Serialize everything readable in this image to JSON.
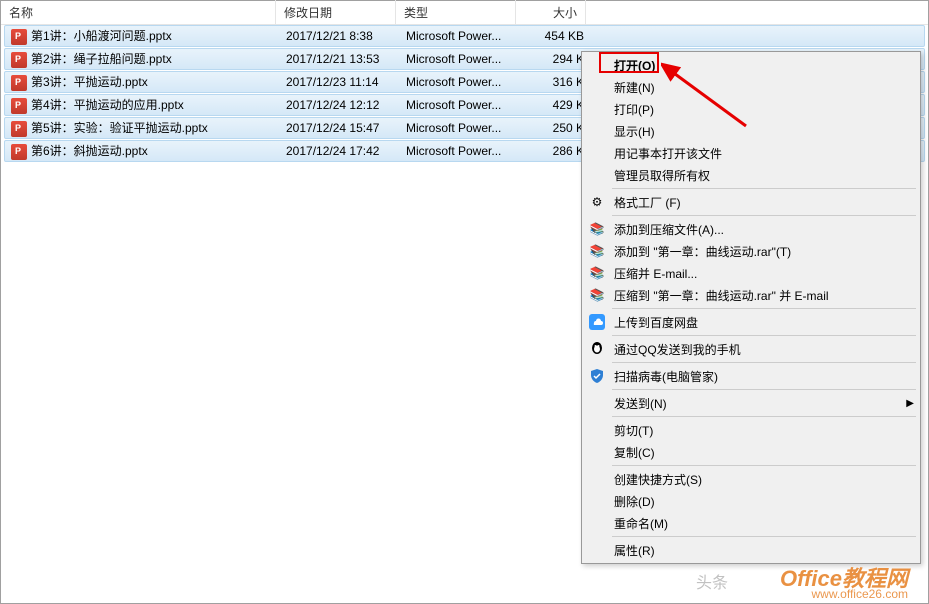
{
  "columns": {
    "name": "名称",
    "date": "修改日期",
    "type": "类型",
    "size": "大小"
  },
  "files": [
    {
      "name": "第1讲：小船渡河问题.pptx",
      "date": "2017/12/21 8:38",
      "type": "Microsoft Power...",
      "size": "454 KB"
    },
    {
      "name": "第2讲：绳子拉船问题.pptx",
      "date": "2017/12/21 13:53",
      "type": "Microsoft Power...",
      "size": "294 K"
    },
    {
      "name": "第3讲：平抛运动.pptx",
      "date": "2017/12/23 11:14",
      "type": "Microsoft Power...",
      "size": "316 K"
    },
    {
      "name": "第4讲：平抛运动的应用.pptx",
      "date": "2017/12/24 12:12",
      "type": "Microsoft Power...",
      "size": "429 K"
    },
    {
      "name": "第5讲：实验：验证平抛运动.pptx",
      "date": "2017/12/24 15:47",
      "type": "Microsoft Power...",
      "size": "250 K"
    },
    {
      "name": "第6讲：斜抛运动.pptx",
      "date": "2017/12/24 17:42",
      "type": "Microsoft Power...",
      "size": "286 K"
    }
  ],
  "menu": {
    "open": "打开(O)",
    "new": "新建(N)",
    "print": "打印(P)",
    "show": "显示(H)",
    "notepad": "用记事本打开该文件",
    "admin": "管理员取得所有权",
    "format": "格式工厂 (F)",
    "archive_add": "添加到压缩文件(A)...",
    "archive_addto": "添加到 \"第一章：曲线运动.rar\"(T)",
    "archive_email": "压缩并 E-mail...",
    "archive_email_to": "压缩到 \"第一章：曲线运动.rar\" 并 E-mail",
    "baidu": "上传到百度网盘",
    "qq": "通过QQ发送到我的手机",
    "scan": "扫描病毒(电脑管家)",
    "sendto": "发送到(N)",
    "cut": "剪切(T)",
    "copy": "复制(C)",
    "shortcut": "创建快捷方式(S)",
    "delete": "删除(D)",
    "rename": "重命名(M)",
    "properties": "属性(R)"
  },
  "watermark": {
    "main": "Office教程网",
    "sub": "www.office26.com",
    "extra": "头条"
  }
}
